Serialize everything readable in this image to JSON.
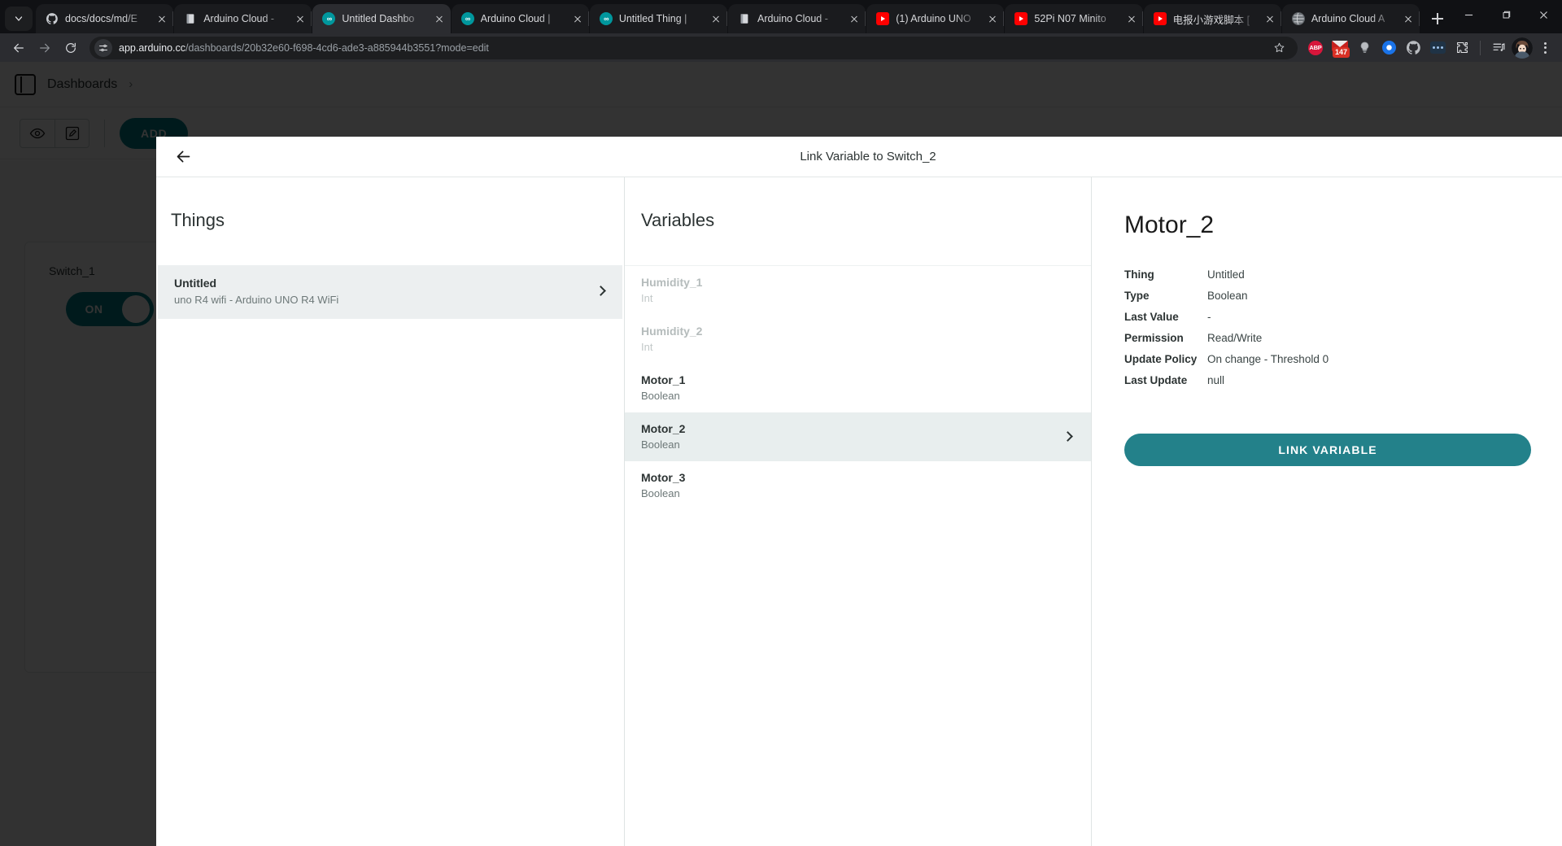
{
  "browser": {
    "tab_search_icon": "chevron-down-icon",
    "tabs": [
      {
        "title": "docs/docs/md/E",
        "favicon": "github-icon",
        "active": false
      },
      {
        "title": "Arduino Cloud -",
        "favicon": "document-icon",
        "active": false
      },
      {
        "title": "Untitled Dashbo",
        "favicon": "arduino-icon",
        "active": true
      },
      {
        "title": "Arduino Cloud |",
        "favicon": "arduino-icon",
        "active": false
      },
      {
        "title": "Untitled Thing |",
        "favicon": "arduino-icon",
        "active": false
      },
      {
        "title": "Arduino Cloud -",
        "favicon": "document-icon",
        "active": false
      },
      {
        "title": "(1) Arduino UNO",
        "favicon": "youtube-icon",
        "active": false
      },
      {
        "title": "52Pi N07 Minito",
        "favicon": "youtube-icon",
        "active": false
      },
      {
        "title": "电报小游戏脚本 [",
        "favicon": "youtube-icon",
        "active": false
      },
      {
        "title": "Arduino Cloud A",
        "favicon": "globe-icon",
        "active": false
      }
    ],
    "new_tab_label": "+",
    "window_controls": [
      "minimize",
      "maximize",
      "close"
    ],
    "nav": {
      "back_icon": "arrow-left-icon",
      "forward_icon": "arrow-right-icon",
      "reload_icon": "reload-icon"
    },
    "omnibox": {
      "site_icon": "site-settings-icon",
      "url_host": "app.arduino.cc",
      "url_path": "/dashboards/20b32e60-f698-4cd6-ade3-a885944b3551?mode=edit",
      "bookmark_icon": "star-icon"
    },
    "extensions": [
      {
        "name": "adblock-plus-icon",
        "label": "ABP"
      },
      {
        "name": "mail-icon",
        "badge": "147"
      },
      {
        "name": "lightbulb-icon"
      },
      {
        "name": "opera-icon"
      },
      {
        "name": "github-icon"
      },
      {
        "name": "dots-extension-icon"
      },
      {
        "name": "puzzle-extensions-icon"
      }
    ],
    "media_icon": "media-playlist-icon",
    "avatar_icon": "profile-avatar",
    "menu_icon": "kebab-menu-icon"
  },
  "dashboard": {
    "panel_toggle_icon": "side-panel-icon",
    "breadcrumb": "Dashboards",
    "breadcrumb_chevron": "chevron-right-icon",
    "view_icon": "eye-icon",
    "edit_icon": "edit-pencil-icon",
    "add_label": "ADD",
    "widget": {
      "title": "Switch_1",
      "state_label": "ON"
    }
  },
  "modal": {
    "back_icon": "arrow-left-icon",
    "title": "Link Variable to Switch_2",
    "things": {
      "heading": "Things",
      "items": [
        {
          "name": "Untitled",
          "subtitle": "uno R4 wifi - Arduino UNO R4 WiFi",
          "selected": true,
          "chevron": "chevron-right-icon"
        }
      ]
    },
    "variables": {
      "heading": "Variables",
      "items": [
        {
          "name": "Humidity_1",
          "type": "Int",
          "disabled": true,
          "selected": false
        },
        {
          "name": "Humidity_2",
          "type": "Int",
          "disabled": true,
          "selected": false
        },
        {
          "name": "Motor_1",
          "type": "Boolean",
          "disabled": false,
          "selected": false
        },
        {
          "name": "Motor_2",
          "type": "Boolean",
          "disabled": false,
          "selected": true
        },
        {
          "name": "Motor_3",
          "type": "Boolean",
          "disabled": false,
          "selected": false
        }
      ]
    },
    "detail": {
      "title": "Motor_2",
      "fields": [
        {
          "key": "Thing",
          "value": "Untitled"
        },
        {
          "key": "Type",
          "value": "Boolean"
        },
        {
          "key": "Last Value",
          "value": "-"
        },
        {
          "key": "Permission",
          "value": "Read/Write"
        },
        {
          "key": "Update Policy",
          "value": "On change - Threshold 0"
        },
        {
          "key": "Last Update",
          "value": "null"
        }
      ],
      "link_button_label": "LINK VARIABLE"
    }
  },
  "colors": {
    "accent_teal": "#23818a",
    "dashboard_teal": "#00818a",
    "selected_row": "#e8eeee",
    "thing_row": "#eceff0",
    "tab_active": "#2b2c30",
    "badge_red": "#d93025"
  }
}
